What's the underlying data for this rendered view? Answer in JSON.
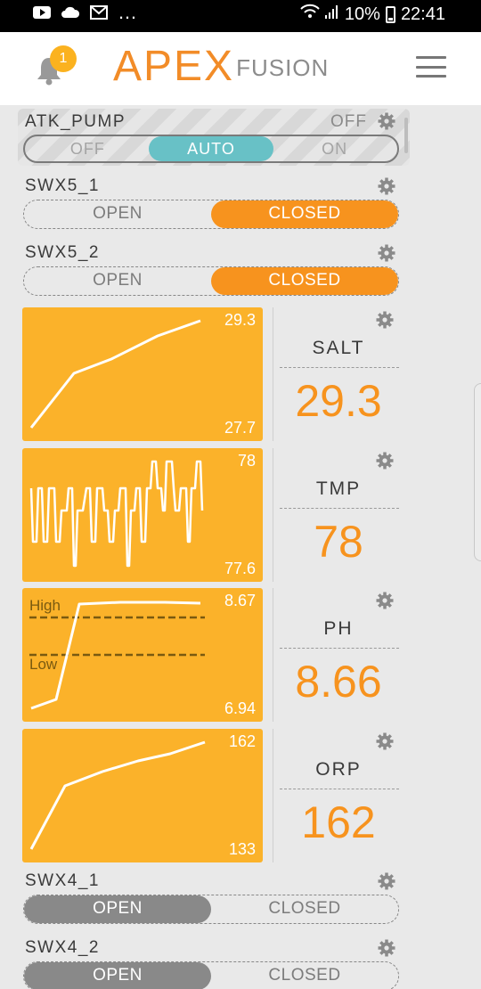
{
  "status_bar": {
    "battery": "10%",
    "time": "22:41"
  },
  "header": {
    "notification_count": "1",
    "logo_main": "APEX",
    "logo_sub": "FUSION"
  },
  "outlets": {
    "atk_pump": {
      "name": "ATK_PUMP",
      "state": "OFF",
      "options": [
        "OFF",
        "AUTO",
        "ON"
      ],
      "selected": "AUTO"
    },
    "swx5_1": {
      "name": "SWX5_1",
      "open_label": "OPEN",
      "closed_label": "CLOSED",
      "selected": "CLOSED"
    },
    "swx5_2": {
      "name": "SWX5_2",
      "open_label": "OPEN",
      "closed_label": "CLOSED",
      "selected": "CLOSED"
    },
    "swx4_1": {
      "name": "SWX4_1",
      "open_label": "OPEN",
      "closed_label": "CLOSED",
      "selected": "OPEN"
    },
    "swx4_2": {
      "name": "SWX4_2",
      "open_label": "OPEN",
      "closed_label": "CLOSED",
      "selected": "OPEN"
    }
  },
  "probes": [
    {
      "name": "SALT",
      "value": "29.3",
      "max": "29.3",
      "min": "27.7"
    },
    {
      "name": "TMP",
      "value": "78",
      "max": "78",
      "min": "77.6"
    },
    {
      "name": "PH",
      "value": "8.66",
      "max": "8.67",
      "min": "6.94",
      "high_label": "High",
      "low_label": "Low"
    },
    {
      "name": "ORP",
      "value": "162",
      "max": "162",
      "min": "133"
    }
  ],
  "colors": {
    "accent_orange": "#f7931e",
    "graph_bg": "#fbb22a",
    "auto_teal": "#68c1c6",
    "open_gray": "#898989"
  }
}
